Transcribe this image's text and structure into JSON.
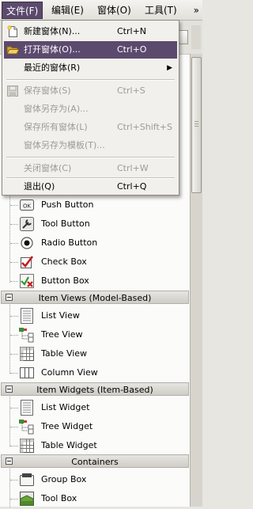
{
  "menubar": {
    "items": [
      {
        "label": "文件(F)"
      },
      {
        "label": "编辑(E)"
      },
      {
        "label": "窗体(O)"
      },
      {
        "label": "工具(T)"
      }
    ],
    "more": "»"
  },
  "file_menu": {
    "items": [
      {
        "label": "新建窗体(N)...",
        "shortcut": "Ctrl+N",
        "icon": "new-file-icon"
      },
      {
        "label": "打开窗体(O)...",
        "shortcut": "Ctrl+O",
        "icon": "open-folder-icon"
      },
      {
        "label": "最近的窗体(R)",
        "shortcut": "",
        "icon": ""
      },
      {
        "label": "保存窗体(S)",
        "shortcut": "Ctrl+S",
        "icon": "save-icon"
      },
      {
        "label": "窗体另存为(A)...",
        "shortcut": "",
        "icon": ""
      },
      {
        "label": "保存所有窗体(L)",
        "shortcut": "Ctrl+Shift+S",
        "icon": ""
      },
      {
        "label": "窗体另存为模板(T)...",
        "shortcut": "",
        "icon": ""
      },
      {
        "label": "关闭窗体(C)",
        "shortcut": "Ctrl+W",
        "icon": ""
      },
      {
        "label": "退出(Q)",
        "shortcut": "Ctrl+Q",
        "icon": ""
      }
    ]
  },
  "widget_box": {
    "buttons": [
      {
        "label": "Push Button",
        "icon": "push-button-icon"
      },
      {
        "label": "Tool Button",
        "icon": "tool-button-icon"
      },
      {
        "label": "Radio Button",
        "icon": "radio-button-icon"
      },
      {
        "label": "Check Box",
        "icon": "check-box-icon"
      },
      {
        "label": "Button Box",
        "icon": "button-box-icon"
      }
    ],
    "item_views": {
      "header": "Item Views (Model-Based)",
      "items": [
        {
          "label": "List View",
          "icon": "list-view-icon"
        },
        {
          "label": "Tree View",
          "icon": "tree-view-icon"
        },
        {
          "label": "Table View",
          "icon": "table-view-icon"
        },
        {
          "label": "Column View",
          "icon": "column-view-icon"
        }
      ]
    },
    "item_widgets": {
      "header": "Item Widgets (Item-Based)",
      "items": [
        {
          "label": "List Widget",
          "icon": "list-widget-icon"
        },
        {
          "label": "Tree Widget",
          "icon": "tree-widget-icon"
        },
        {
          "label": "Table Widget",
          "icon": "table-widget-icon"
        }
      ]
    },
    "containers": {
      "header": "Containers",
      "items": [
        {
          "label": "Group Box",
          "icon": "group-box-icon"
        },
        {
          "label": "Tool Box",
          "icon": "tool-box-icon"
        }
      ]
    }
  },
  "colors": {
    "highlight": "#5c4a6e",
    "disabled_text": "#9e9b94",
    "menu_bg": "#f1f0ec"
  }
}
